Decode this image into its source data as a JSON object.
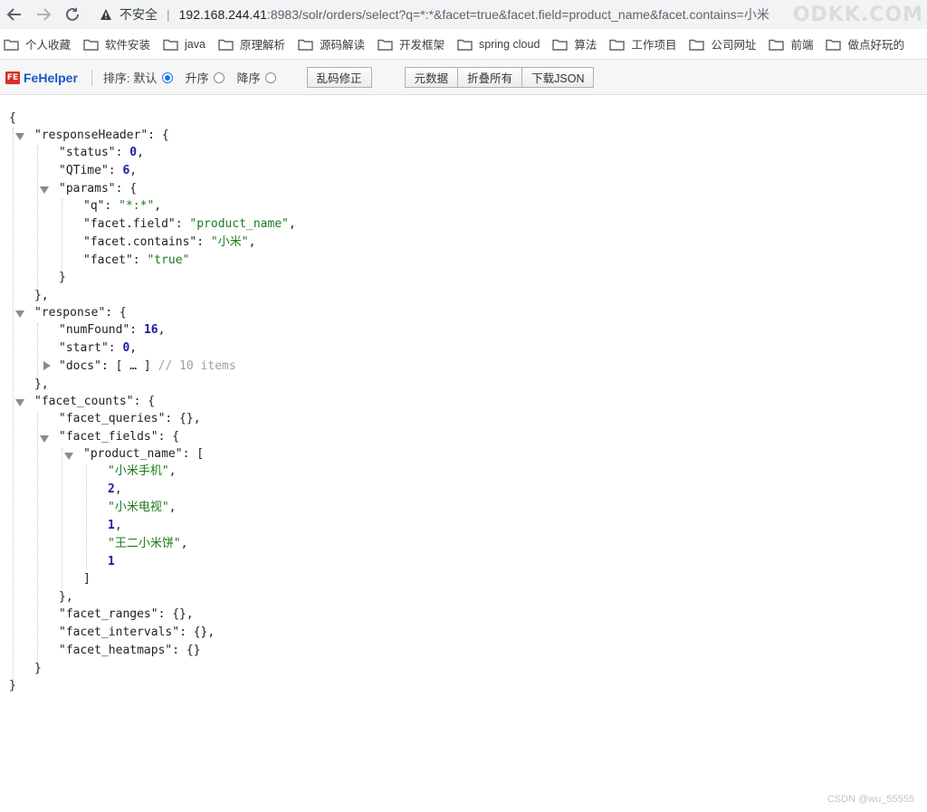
{
  "browser": {
    "insecure_label": "不安全",
    "url_host": "192.168.244.41",
    "url_rest": ":8983/solr/orders/select?q=*:*&facet=true&facet.field=product_name&facet.contains=小米",
    "watermark": "ODKK.COM"
  },
  "bookmarks": [
    "个人收藏",
    "软件安装",
    "java",
    "原理解析",
    "源码解读",
    "开发框架",
    "spring cloud",
    "算法",
    "工作项目",
    "公司网址",
    "前端",
    "做点好玩的"
  ],
  "fehelper": {
    "title": "FeHelper",
    "sort_label": "排序:",
    "sort_default": "默认",
    "sort_asc": "升序",
    "sort_desc": "降序",
    "fix_button": "乱码修正",
    "meta_button": "元数据",
    "collapse_button": "折叠所有",
    "download_button": "下载JSON"
  },
  "json": {
    "responseHeader": {
      "status": "0",
      "QTime": "6",
      "params": {
        "q": "*:*",
        "facet_field": "product_name",
        "facet_contains": "小米",
        "facet": "true"
      }
    },
    "response": {
      "numFound": "16",
      "start": "0",
      "docs_comment": "// 10 items"
    },
    "facet_counts": {
      "product_name": [
        "小米手机",
        "2",
        "小米电视",
        "1",
        "王二小米饼",
        "1"
      ]
    }
  },
  "footer_watermark": "CSDN @wu_55555"
}
